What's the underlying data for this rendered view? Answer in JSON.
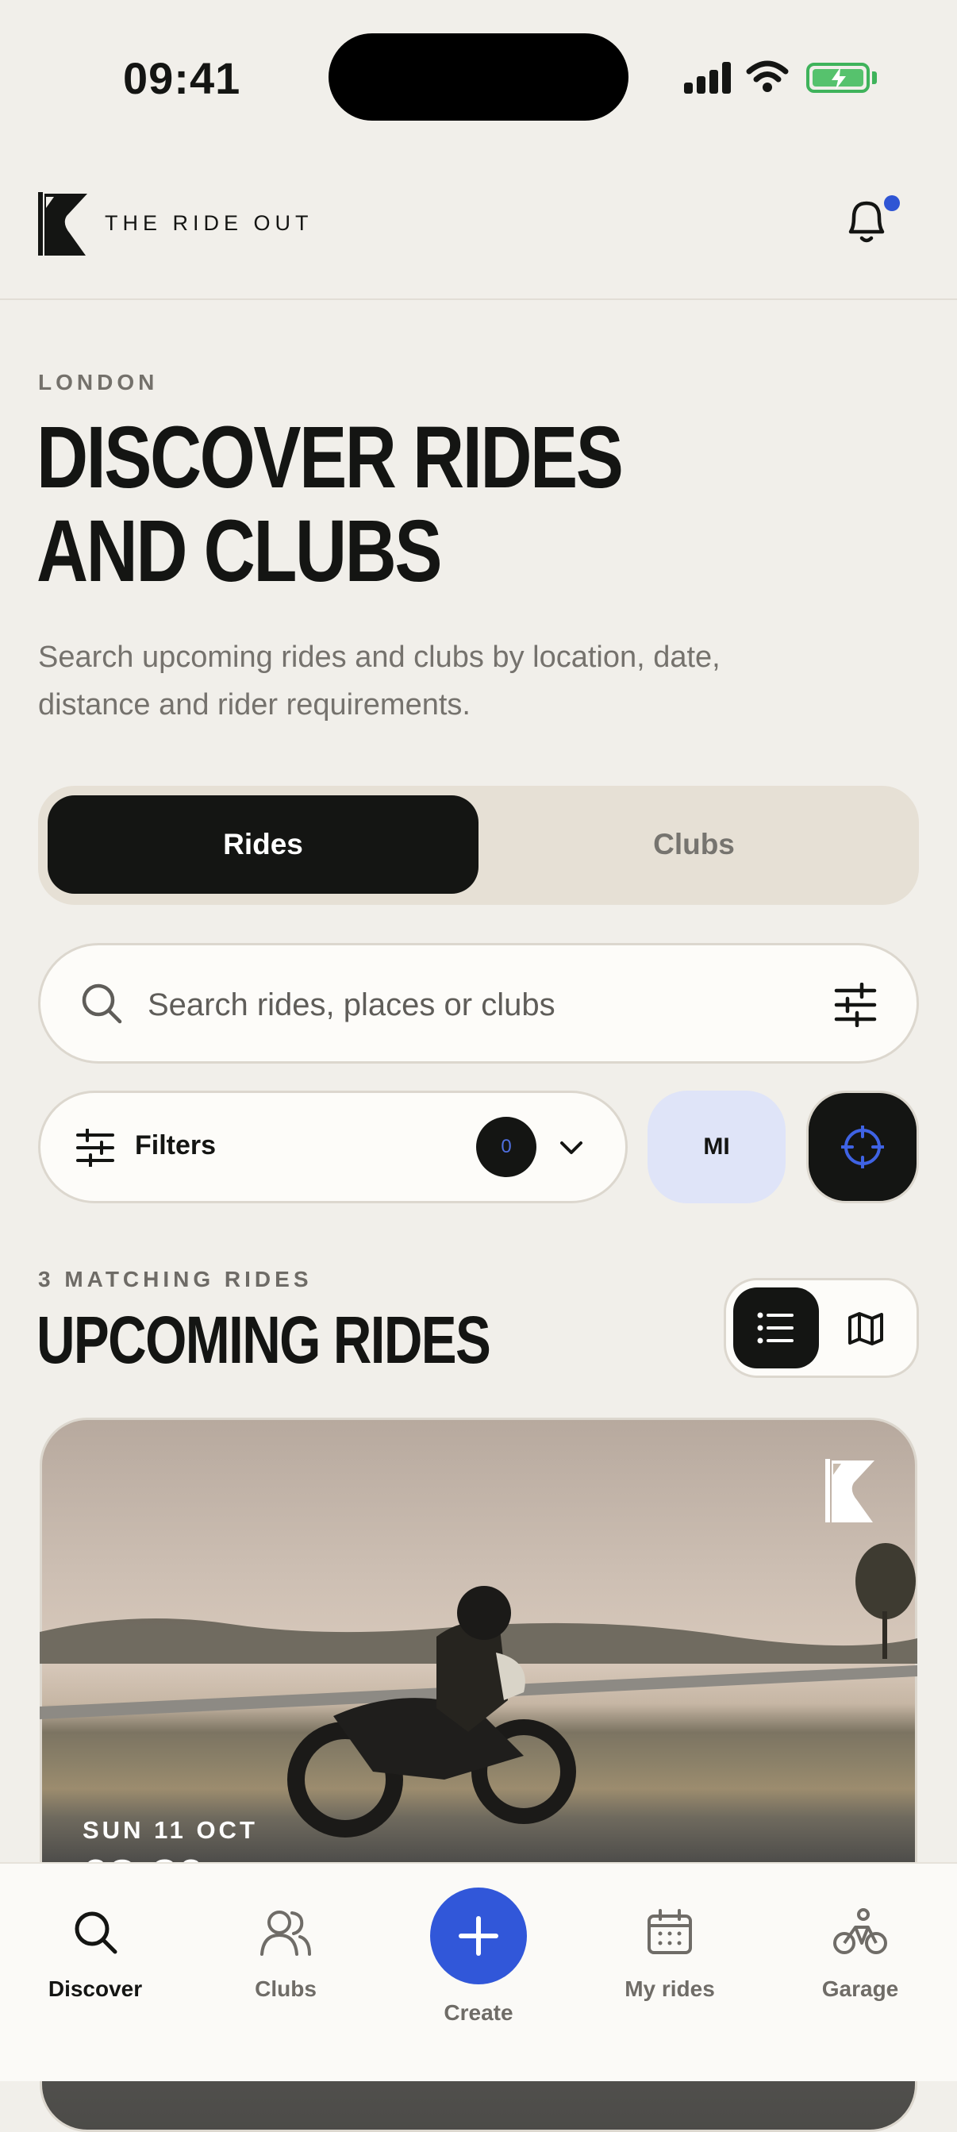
{
  "status_bar": {
    "time": "09:41"
  },
  "header": {
    "brand": "THE RIDE OUT",
    "notification_dot_color": "#2f55d4"
  },
  "hero": {
    "city": "LONDON",
    "title_line1": "DISCOVER RIDES",
    "title_line2": "AND CLUBS",
    "subtitle": "Search upcoming rides and clubs by location, date, distance and rider requirements."
  },
  "segmented": {
    "rides_label": "Rides",
    "clubs_label": "Clubs",
    "selected": "Rides"
  },
  "search": {
    "placeholder": "Search rides, places or clubs",
    "value": ""
  },
  "filters": {
    "label": "Filters",
    "count": "0",
    "unit_label": "MI"
  },
  "section": {
    "count_label": "3 MATCHING RIDES",
    "title": "UPCOMING RIDES",
    "view_mode": "list"
  },
  "card": {
    "date": "SUN 11 OCT",
    "time": "08:30"
  },
  "tabbar": {
    "items": [
      {
        "label": "Discover",
        "icon": "search-icon",
        "active": true
      },
      {
        "label": "Clubs",
        "icon": "users-icon",
        "active": false
      },
      {
        "label": "Create",
        "icon": "plus-icon",
        "active": false
      },
      {
        "label": "My rides",
        "icon": "calendar-icon",
        "active": false
      },
      {
        "label": "Garage",
        "icon": "bike-icon",
        "active": false
      }
    ]
  },
  "colors": {
    "accent": "#3157d9",
    "background": "#f1efea",
    "dark": "#141513"
  }
}
